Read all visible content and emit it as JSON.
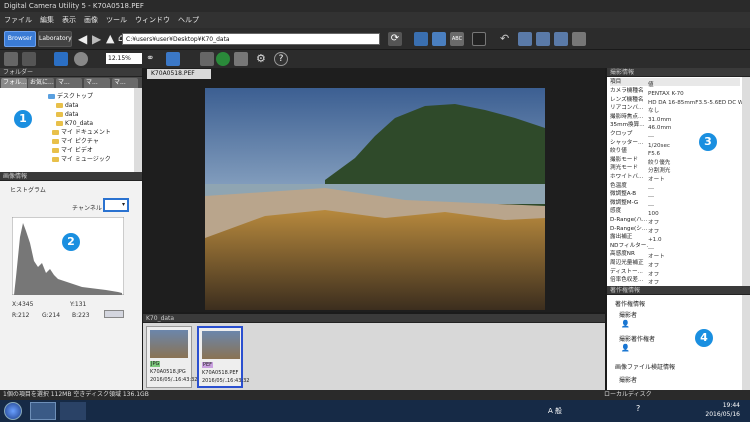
{
  "window": {
    "title": "Digital Camera Utility 5 - K70A0518.PEF"
  },
  "menu": [
    "ファイル",
    "編集",
    "表示",
    "画像",
    "ツール",
    "ウィンドウ",
    "ヘルプ"
  ],
  "toolbar": {
    "browser_label": "Browser",
    "laboratory_label": "Laboratory",
    "address": "C:¥users¥user¥Desktop¥K70_data",
    "zoom": "12.15%"
  },
  "folder_panel": {
    "header": "フォルダー",
    "tabs": [
      "フォル...",
      "お気に...",
      "マ...",
      "マ...",
      "マ..."
    ],
    "items": [
      "デスクトップ",
      "data",
      "data",
      "K70_data",
      "マイ ドキュメント",
      "マイ ピクチャ",
      "マイ ビデオ",
      "マイ ミュージック"
    ]
  },
  "histogram_panel": {
    "header": "画像情報",
    "title": "ヒストグラム",
    "channel_label": "チャンネル",
    "x": "X:4345",
    "y": "Y:131",
    "r": "R:212",
    "g": "G:214",
    "b": "B:223"
  },
  "viewer": {
    "tab": "K70A0518.PEF"
  },
  "thumbs": {
    "header": "K70_data",
    "items": [
      {
        "type": "JPG",
        "name": "K70A0518.JPG",
        "date": "2016/05/...",
        "time": "16:43:32"
      },
      {
        "type": "PEF",
        "name": "K70A0518.PEF",
        "date": "2016/05/...",
        "time": "16:43:32"
      }
    ]
  },
  "info_panel": {
    "header": "撮影情報",
    "col_item": "項目",
    "col_value": "値",
    "rows": [
      [
        "カメラ機種名",
        "PENTAX K-70"
      ],
      [
        "レンズ機種名",
        "HD DA 16-85mmF3.5-5.6ED DC WR"
      ],
      [
        "リアコンバ...",
        "なし"
      ],
      [
        "撮影時焦点...",
        "31.0mm"
      ],
      [
        "35mm換算...",
        "46.0mm"
      ],
      [
        "クロップ",
        "---"
      ],
      [
        "シャッター...",
        "1/20sec"
      ],
      [
        "絞り値",
        "F5.6"
      ],
      [
        "撮影モード",
        "絞り優先"
      ],
      [
        "測光モード",
        "分割測光"
      ],
      [
        "ホワイトバ...",
        "オート"
      ],
      [
        "色温度",
        "---"
      ],
      [
        "微調整A-B",
        "---"
      ],
      [
        "微調整M-G",
        "---"
      ],
      [
        "感度",
        "100"
      ],
      [
        "D-Range(ハ...",
        "オフ"
      ],
      [
        "D-Range(シ...",
        "オフ"
      ],
      [
        "露出補正",
        "+1.0"
      ],
      [
        "NDフィルター...",
        "---"
      ],
      [
        "高感度NR",
        "オート"
      ],
      [
        "周辺光量補正",
        "オフ"
      ],
      [
        "ディストー...",
        "オフ"
      ],
      [
        "倍率色収差...",
        "オフ"
      ]
    ]
  },
  "copyright_panel": {
    "header": "著作権情報",
    "section1": "著作権情報",
    "author": "撮影者",
    "copyright_holder": "撮影著作権者",
    "section2": "画像ファイル検証情報",
    "author2": "撮影者"
  },
  "status": {
    "text": "1個の項目を選択  112MB  空きディスク領域 136.1GB",
    "location": "ローカルディスク"
  },
  "taskbar": {
    "time": "19:44",
    "date": "2016/05/16",
    "ime": "A 般"
  },
  "badges": [
    "1",
    "2",
    "3",
    "4"
  ]
}
